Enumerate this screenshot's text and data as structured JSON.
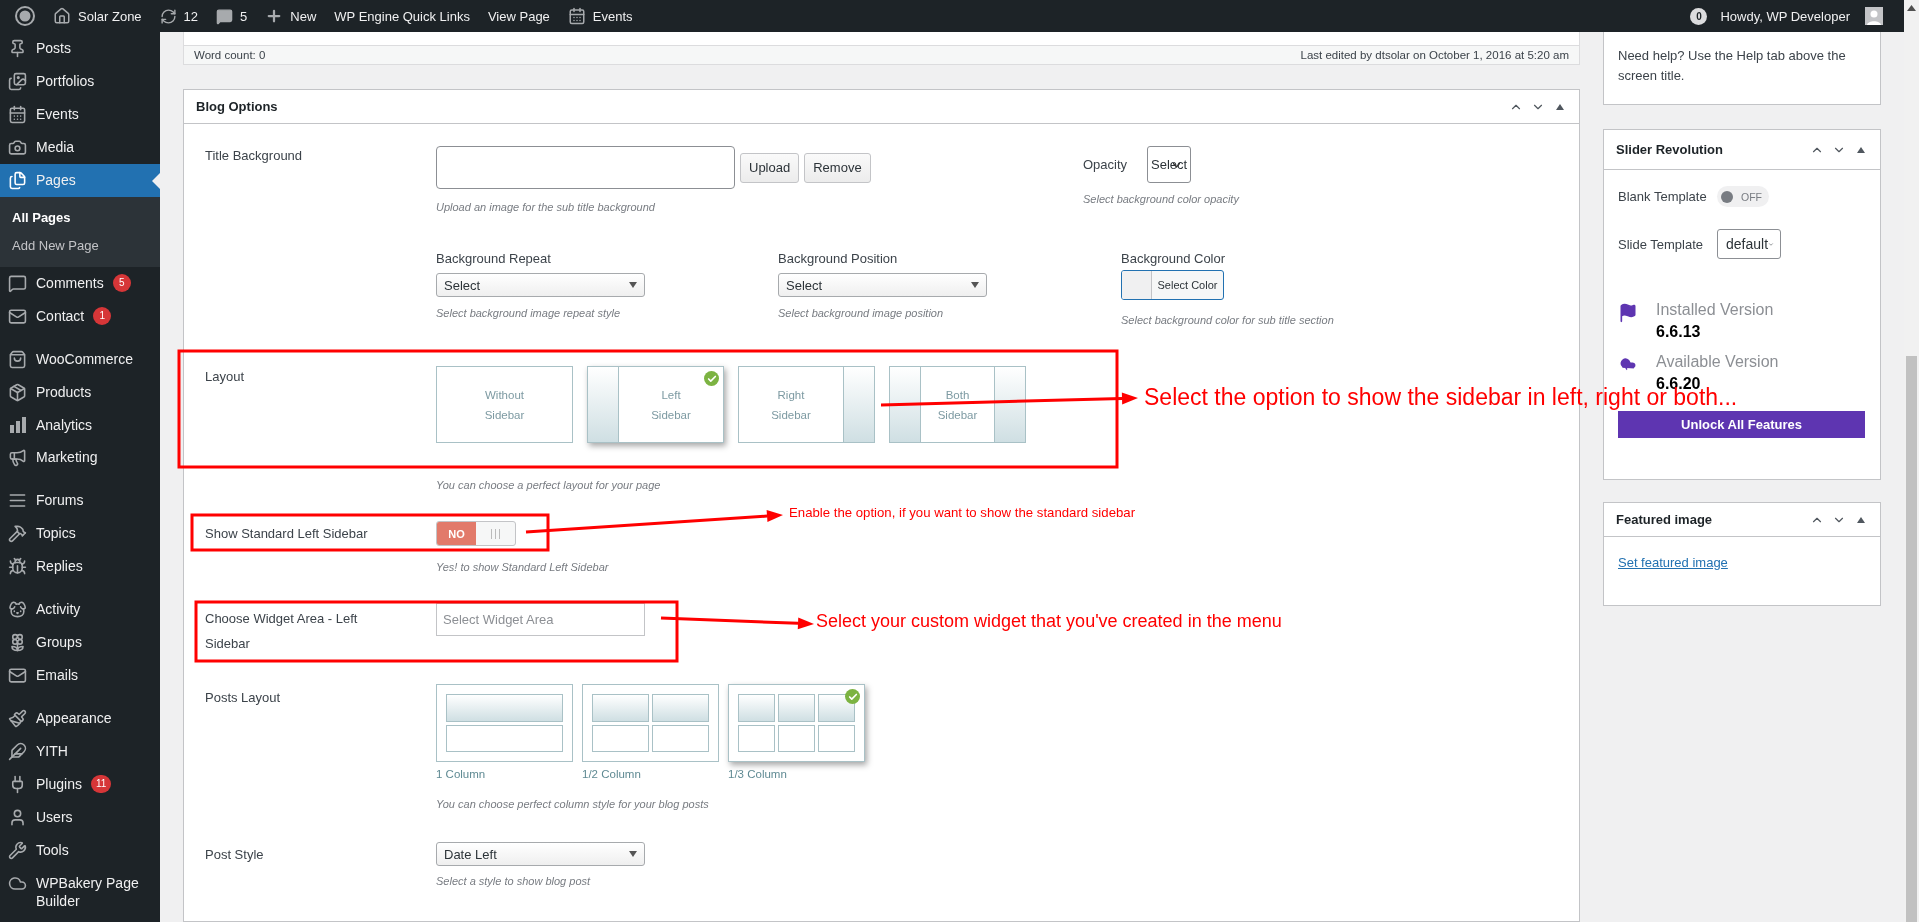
{
  "admin_bar": {
    "site_name": "Solar Zone",
    "updates": "12",
    "comments": "5",
    "new": "New",
    "links": [
      "WP Engine Quick Links",
      "View Page"
    ],
    "events": "Events",
    "notifications": "0",
    "greeting": "Howdy, WP Developer"
  },
  "sidebar": {
    "groups": [
      {
        "items": [
          {
            "label": "Posts",
            "selected": false
          },
          {
            "label": "Portfolios",
            "selected": false
          },
          {
            "label": "Events",
            "selected": false
          },
          {
            "label": "Media",
            "selected": false
          },
          {
            "label": "Pages",
            "selected": true,
            "children": [
              {
                "label": "All Pages",
                "selected": true
              },
              {
                "label": "Add New Page",
                "selected": false
              }
            ]
          },
          {
            "label": "Comments",
            "selected": false,
            "badge": "5"
          },
          {
            "label": "Contact",
            "selected": false,
            "badge": "1"
          }
        ]
      },
      {
        "items": [
          {
            "label": "WooCommerce",
            "selected": false
          },
          {
            "label": "Products",
            "selected": false
          },
          {
            "label": "Analytics",
            "selected": false
          },
          {
            "label": "Marketing",
            "selected": false
          }
        ]
      },
      {
        "items": [
          {
            "label": "Forums",
            "selected": false
          },
          {
            "label": "Topics",
            "selected": false
          },
          {
            "label": "Replies",
            "selected": false
          }
        ]
      },
      {
        "items": [
          {
            "label": "Activity",
            "selected": false
          },
          {
            "label": "Groups",
            "selected": false
          },
          {
            "label": "Emails",
            "selected": false
          }
        ]
      },
      {
        "items": [
          {
            "label": "Appearance",
            "selected": false
          },
          {
            "label": "YITH",
            "selected": false
          },
          {
            "label": "Plugins",
            "selected": false,
            "badge": "11"
          },
          {
            "label": "Users",
            "selected": false
          },
          {
            "label": "Tools",
            "selected": false
          },
          {
            "label": "WPBakery Page Builder",
            "selected": false
          }
        ]
      }
    ]
  },
  "editor_footer": {
    "word_count": "Word count: 0",
    "last_edited": "Last edited by dtsolar on October 1, 2016 at 5:20 am"
  },
  "blog_options": {
    "title": "Blog Options",
    "title_background": {
      "label": "Title Background",
      "buttons": [
        "Upload",
        "Remove"
      ],
      "hint": "Upload an image for the sub title background"
    },
    "opacity": {
      "label": "Opacity",
      "value": "Select",
      "hint": "Select background color opacity"
    },
    "background_fields": [
      {
        "label": "Background Repeat",
        "kind": "select",
        "value": "Select",
        "hint": "Select background image repeat style"
      },
      {
        "label": "Background Position",
        "kind": "select",
        "value": "Select",
        "hint": "Select background image position"
      },
      {
        "label": "Background Color",
        "kind": "color",
        "value": "Select Color",
        "hint": "Select background color for sub title section"
      }
    ],
    "layout": {
      "label": "Layout",
      "options": [
        {
          "label": "Without Sidebar",
          "kind": "none",
          "selected": false
        },
        {
          "label": "Left Sidebar",
          "kind": "left",
          "selected": true
        },
        {
          "label": "Right Sidebar",
          "kind": "right",
          "selected": false
        },
        {
          "label": "Both Sidebar",
          "kind": "both",
          "selected": false
        }
      ],
      "hint": "You can choose a perfect layout for your page"
    },
    "standard_left_sidebar": {
      "label": "Show Standard Left Sidebar",
      "on": false,
      "text": "NO",
      "hint": "Yes! to show Standard Left Sidebar"
    },
    "widget_area": {
      "label": "Choose Widget Area - Left Sidebar",
      "placeholder": "Select Widget Area"
    },
    "posts_layout": {
      "label": "Posts Layout",
      "options": [
        {
          "label": "1 Column",
          "kind": "one",
          "selected": false
        },
        {
          "label": "1/2 Column",
          "kind": "two",
          "selected": false
        },
        {
          "label": "1/3 Column",
          "kind": "three",
          "selected": true
        }
      ],
      "hint": "You can choose perfect column style for your blog posts"
    },
    "post_style": {
      "label": "Post Style",
      "value": "Date Left",
      "hint": "Select a style to show blog post"
    }
  },
  "help_box": {
    "text": "Need help? Use the Help tab above the screen title."
  },
  "slider_revolution": {
    "title": "Slider Revolution",
    "blank_template": {
      "label": "Blank Template",
      "on": false,
      "text": "OFF"
    },
    "slide_template": {
      "label": "Slide Template",
      "value": "default"
    },
    "versions": [
      {
        "label": "Installed Version",
        "value": "6.6.13",
        "kind": "installed"
      },
      {
        "label": "Available Version",
        "value": "6.6.20",
        "kind": "available"
      }
    ],
    "button": "Unlock All Features"
  },
  "featured_image": {
    "title": "Featured image",
    "link": "Set featured image"
  },
  "annotations": [
    {
      "text": "Select the option to show the sidebar in left, right or both..."
    },
    {
      "text": "Enable the option, if you want to show the standard sidebar"
    },
    {
      "text": "Select your custom widget that you've created in the menu"
    }
  ]
}
